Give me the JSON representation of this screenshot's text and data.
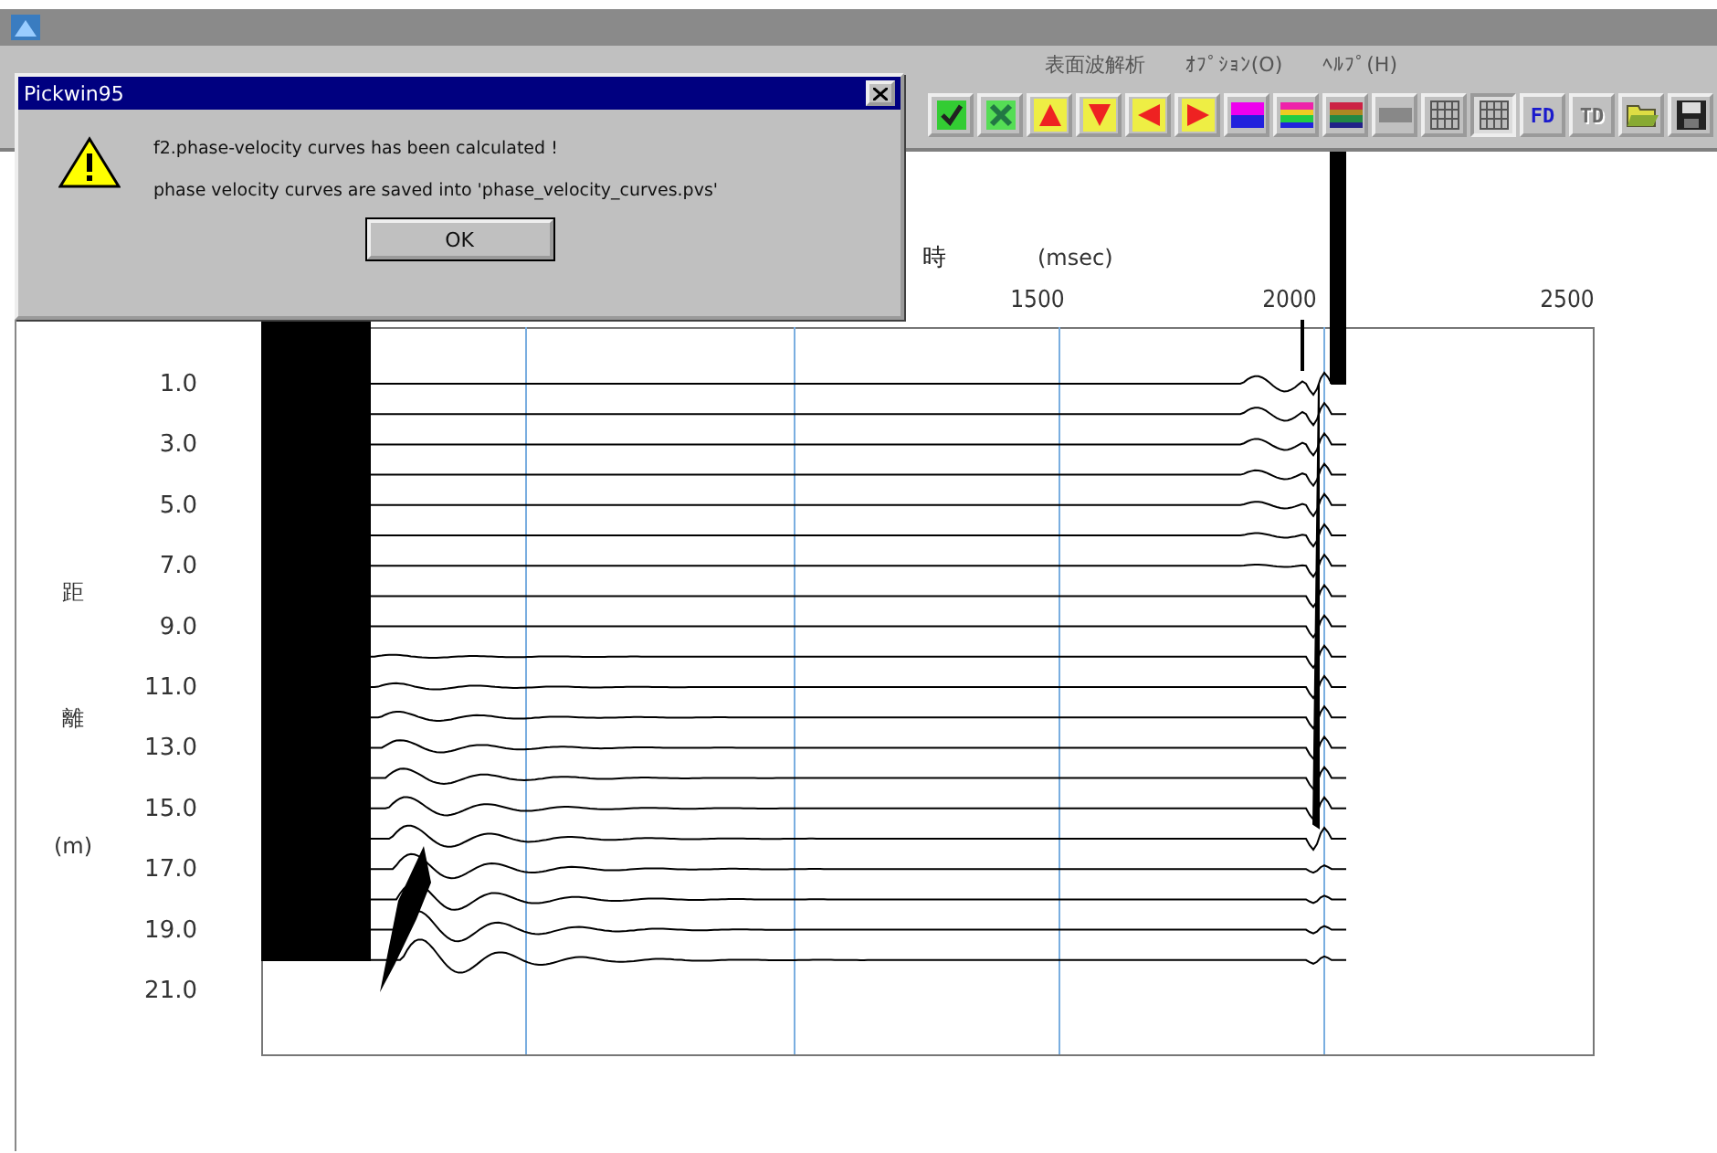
{
  "menu": [
    {
      "label": "表面波解析"
    },
    {
      "label": "ｵﾌﾟｼｮﾝ(O)"
    },
    {
      "label": "ﾍﾙﾌﾟ(H)"
    }
  ],
  "toolbar": [
    {
      "kind": "check",
      "selected": false,
      "disabled": false
    },
    {
      "kind": "cross",
      "selected": false,
      "disabled": false
    },
    {
      "kind": "up",
      "selected": false,
      "disabled": false
    },
    {
      "kind": "down",
      "selected": false,
      "disabled": false
    },
    {
      "kind": "left",
      "selected": false,
      "disabled": false
    },
    {
      "kind": "right",
      "selected": false,
      "disabled": false
    },
    {
      "kind": "bars-two",
      "selected": false,
      "disabled": false
    },
    {
      "kind": "bars-rainbow",
      "selected": false,
      "disabled": false
    },
    {
      "kind": "bars-dark-rainbow",
      "selected": false,
      "disabled": false
    },
    {
      "kind": "bars-gray",
      "selected": false,
      "disabled": false
    },
    {
      "kind": "grid",
      "selected": false,
      "disabled": false
    },
    {
      "kind": "grid",
      "selected": true,
      "disabled": false
    },
    {
      "kind": "text",
      "label": "FD",
      "selected": false,
      "disabled": false
    },
    {
      "kind": "text",
      "label": "TD",
      "selected": false,
      "disabled": true
    },
    {
      "kind": "open",
      "selected": false,
      "disabled": false
    },
    {
      "kind": "save",
      "selected": false,
      "disabled": false
    }
  ],
  "plot": {
    "x_label": "時",
    "x_unit": "(msec)",
    "x_ticks": [
      "1500",
      "2000",
      "2500"
    ],
    "y_label": [
      "距",
      "離",
      "(m)"
    ],
    "y_ticks": [
      "1.0",
      "3.0",
      "5.0",
      "7.0",
      "9.0",
      "11.0",
      "13.0",
      "15.0",
      "17.0",
      "19.0",
      "21.0"
    ]
  },
  "dialog": {
    "title": "Pickwin95",
    "message_lines": [
      "f2.phase-velocity curves has been calculated !",
      "phase velocity curves are saved into 'phase_velocity_curves.pvs'"
    ],
    "button": "OK"
  }
}
